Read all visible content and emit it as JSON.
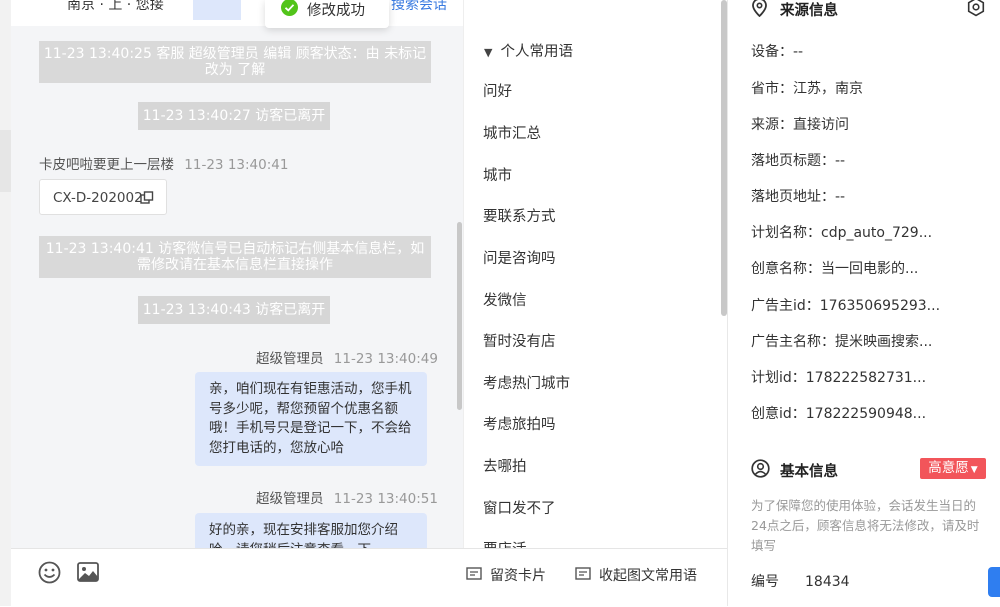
{
  "top_bar": {
    "left_text": "南京 · 上 · 您接",
    "right_link": "搜索会话"
  },
  "toast": {
    "text": "修改成功",
    "color": "#52c41a"
  },
  "chat": {
    "sys1": "11-23 13:40:25 客服 超级管理员 编辑 顾客状态：由 未标记 改为 了解",
    "sys2": "11-23 13:40:27 访客已离开",
    "visitor_name": "卡皮吧啦要更上一层楼",
    "visitor_time": "11-23 13:40:41",
    "card_text": "CX-D-202002",
    "sys3": "11-23 13:40:41 访客微信号已自动标记右侧基本信息栏，如需修改请在基本信息栏直接操作",
    "sys4": "11-23 13:40:43 访客已离开",
    "agent1_name": "超级管理员",
    "agent1_time": "11-23 13:40:49",
    "agent1_msg": "亲，咱们现在有钜惠活动，您手机号多少呢，帮您预留个优惠名额哦！手机号只是登记一下，不会给您打电话的，您放心哈",
    "agent2_name": "超级管理员",
    "agent2_time": "11-23 13:40:51",
    "agent2_msg": "好的亲，现在安排客服加您介绍哈，请您稍后注意查看，下"
  },
  "bottom": {
    "emoji_icon": "smile-icon",
    "image_icon": "image-icon",
    "btn_card": "留资卡片",
    "btn_collapse": "收起图文常用语"
  },
  "phrases": {
    "header": "个人常用语",
    "items": [
      "问好",
      "城市汇总",
      "城市",
      "要联系方式",
      "问是咨询吗",
      "发微信",
      "暂时没有店",
      "考虑热门城市",
      "考虑旅拍吗",
      "去哪拍",
      "窗口发不了",
      "要店活"
    ]
  },
  "source": {
    "title": "来源信息",
    "device": "设备：--",
    "province": "省市：江苏，南京",
    "origin": "来源：直接访问",
    "landing_title": "落地页标题：--",
    "landing_url": "落地页地址：--",
    "plan_name": "计划名称：cdp_auto_729...",
    "creative_name": "创意名称：当一回电影的...",
    "advertiser_id": "广告主id：176350695293...",
    "advertiser_name": "广告主名称：提米映画搜索...",
    "plan_id": "计划id：178222582731...",
    "creative_id": "创意id：178222590948..."
  },
  "basic": {
    "title": "基本信息",
    "badge": "高意愿",
    "badge_color": "#f2555a",
    "notice": "为了保障您的使用体验，会话发生当日的24点之后，顾客信息将无法修改，请及时填写",
    "id_label": "编号",
    "id_value": "18434"
  }
}
